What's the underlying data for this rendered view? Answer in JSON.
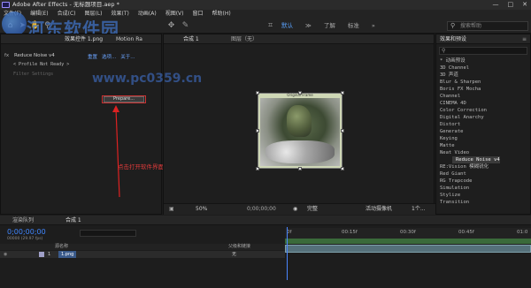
{
  "titlebar": {
    "title": "Adobe After Effects - 无标题项目.aep *",
    "controls": [
      "—",
      "□",
      "✕"
    ]
  },
  "menubar": {
    "items": [
      "文件(F)",
      "编辑(E)",
      "合成(C)",
      "图层(L)",
      "效果(T)",
      "动画(A)",
      "视图(V)",
      "窗口",
      "帮助(H)"
    ]
  },
  "workspace": {
    "items": [
      "默认",
      "≫",
      "了解",
      "标准",
      "»"
    ],
    "active": "默认"
  },
  "help_search": {
    "placeholder": "搜索帮助"
  },
  "effects_panel": {
    "tab": "效果控件 1.png",
    "comp_label": "Motion Ra",
    "effect_name": "Reduce Noise v4",
    "fx_prefix": "fx",
    "links": [
      "重置",
      "选项...",
      "关于..."
    ],
    "profile_label": "Profile Not Ready",
    "filter_label": "Filter Settings",
    "prepare_button": "Prepare..."
  },
  "comp_viewer": {
    "tab": "合成 1",
    "layer_label": "图层（无）",
    "frame_caption": "Original Frame",
    "footer": {
      "zoom": "50%",
      "timecode": "0;00;00;00",
      "quality": "完整",
      "camera": "活动摄像机",
      "views": "1个..."
    }
  },
  "effects_presets": {
    "tab": "效果和预设",
    "search_placeholder": "",
    "items": [
      "* 动画预设",
      "3D Channel",
      "3D 声道",
      "Blur & Sharpen",
      "Boris FX Mocha",
      "Channel",
      "CINEMA 4D",
      "Color Correction",
      "Digital Anarchy",
      "Distort",
      "Generate",
      "Keying",
      "Matte",
      "Neat Video",
      "Reduce Noise v4",
      "RE:Vision 模糊锐化",
      "Red Giant",
      "RG Trapcode",
      "Simulation",
      "Stylize",
      "Transition"
    ],
    "selected": "Reduce Noise v4"
  },
  "watermark": {
    "title": "河东软件园",
    "url": "www.pc0359.cn"
  },
  "annotation": {
    "text": "点击打开软件界面"
  },
  "timeline": {
    "tab": "渲染队列",
    "comp_tab": "合成 1",
    "timecode": "0;00;00;00",
    "fps": "00000 (29.97 fps)",
    "columns": {
      "source": "源名称",
      "parent": "父级和链接"
    },
    "layer": {
      "number": "1",
      "name": "1.png",
      "parent": "无"
    },
    "ruler": [
      "0f",
      "00:15f",
      "00:30f",
      "00:45f",
      "01:0"
    ]
  }
}
